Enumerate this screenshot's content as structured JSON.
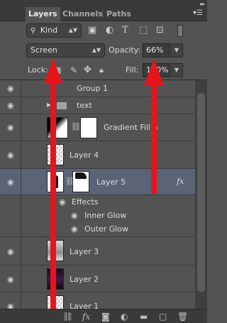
{
  "tabs": [
    {
      "label": "Layers",
      "active": true
    },
    {
      "label": "Channels",
      "active": false
    },
    {
      "label": "Paths",
      "active": false
    }
  ],
  "filter": {
    "kind_label": "Kind",
    "icons": [
      "image-filter-icon",
      "adjustment-filter-icon",
      "type-filter-icon",
      "shape-filter-icon",
      "smart-object-filter-icon",
      "filter-toggle-icon"
    ]
  },
  "blend": {
    "mode": "Screen",
    "opacity_label": "Opacity:",
    "opacity_value": "66%"
  },
  "lock": {
    "label": "Lock:",
    "fill_label": "Fill:",
    "fill_value": "100%"
  },
  "layers": [
    {
      "name": "Group 1",
      "type": "group-header"
    },
    {
      "name": "text",
      "type": "folder"
    },
    {
      "name": "Gradient Fill 6",
      "type": "fill"
    },
    {
      "name": "Layer 4",
      "type": "layer"
    },
    {
      "name": "Layer 5",
      "type": "layer",
      "selected": true,
      "fx": "fx"
    },
    {
      "name": "Effects",
      "type": "effects"
    },
    {
      "name": "Inner Glow",
      "type": "effect"
    },
    {
      "name": "Outer Glow",
      "type": "effect"
    },
    {
      "name": "Layer 3",
      "type": "layer"
    },
    {
      "name": "Layer 2",
      "type": "layer"
    },
    {
      "name": "Layer 1",
      "type": "layer"
    }
  ],
  "bottom_icons": [
    "link-layers-icon",
    "add-style-icon",
    "add-mask-icon",
    "new-adjustment-icon",
    "new-group-icon",
    "new-layer-icon",
    "delete-layer-icon"
  ],
  "colors": {
    "panel": "#535353",
    "selected_row": "#5b6377",
    "annotation_arrow": "#e8141c"
  }
}
